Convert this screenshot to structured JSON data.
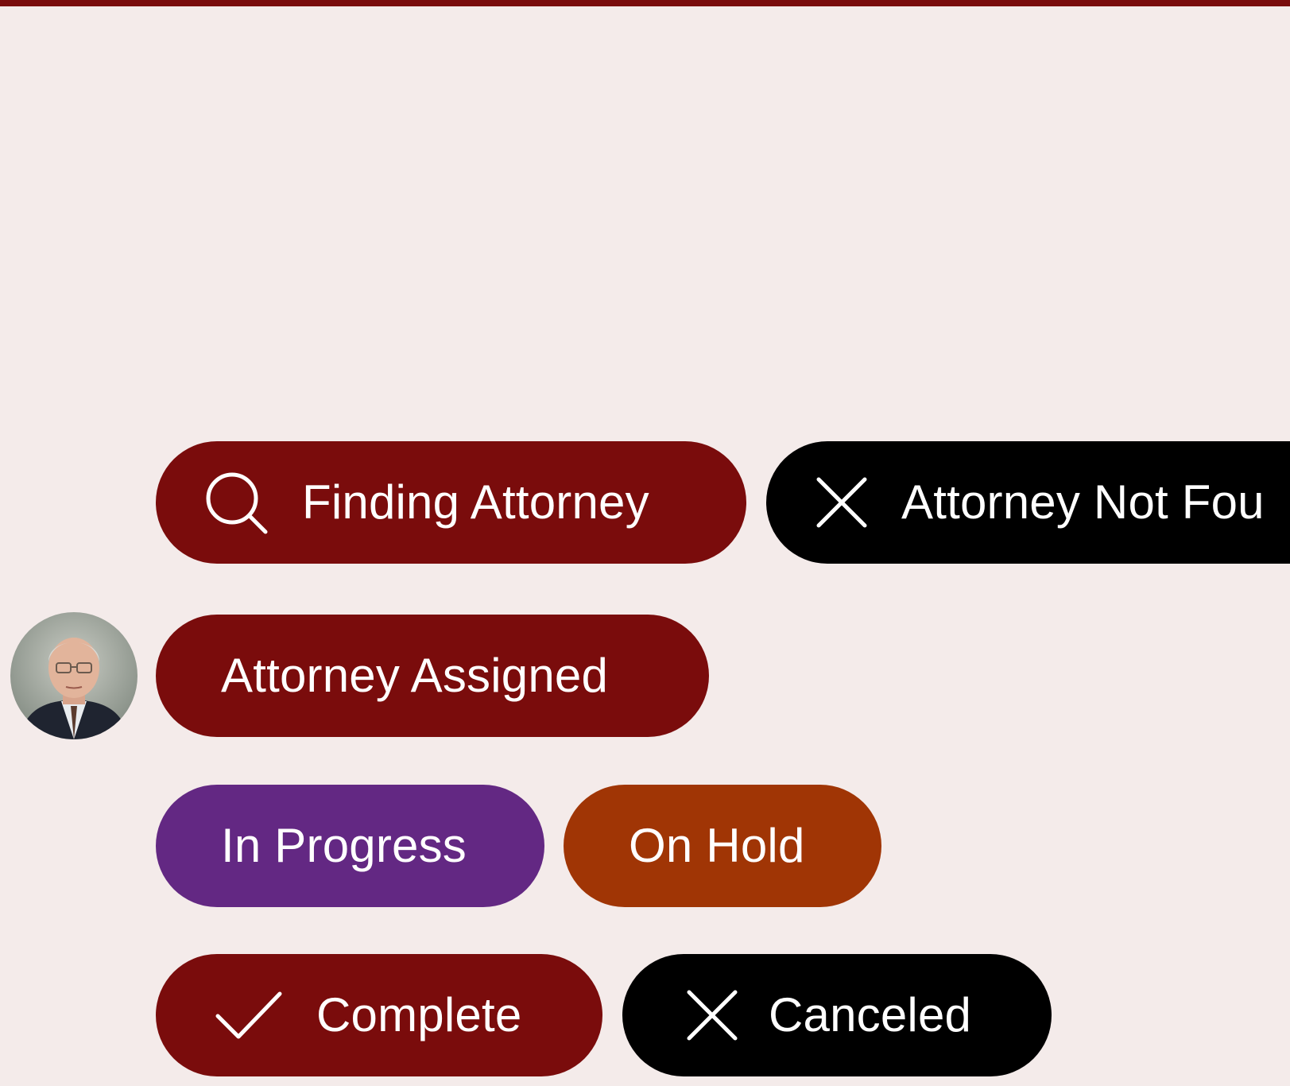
{
  "colors": {
    "background": "#f4ebea",
    "brand": "#7a0c0c",
    "black": "#000000",
    "purple": "#632883",
    "orange": "#a03505",
    "text_on_pill": "#ffffff"
  },
  "statuses": {
    "finding": {
      "label": "Finding Attorney",
      "icon": "search-icon"
    },
    "not_found": {
      "label": "Attorney Not Fou",
      "icon": "close-icon"
    },
    "assigned": {
      "label": "Attorney Assigned",
      "avatar": "attorney-avatar"
    },
    "in_progress": {
      "label": "In Progress"
    },
    "on_hold": {
      "label": "On Hold"
    },
    "complete": {
      "label": "Complete",
      "icon": "check-icon"
    },
    "canceled": {
      "label": "Canceled",
      "icon": "close-icon"
    }
  }
}
